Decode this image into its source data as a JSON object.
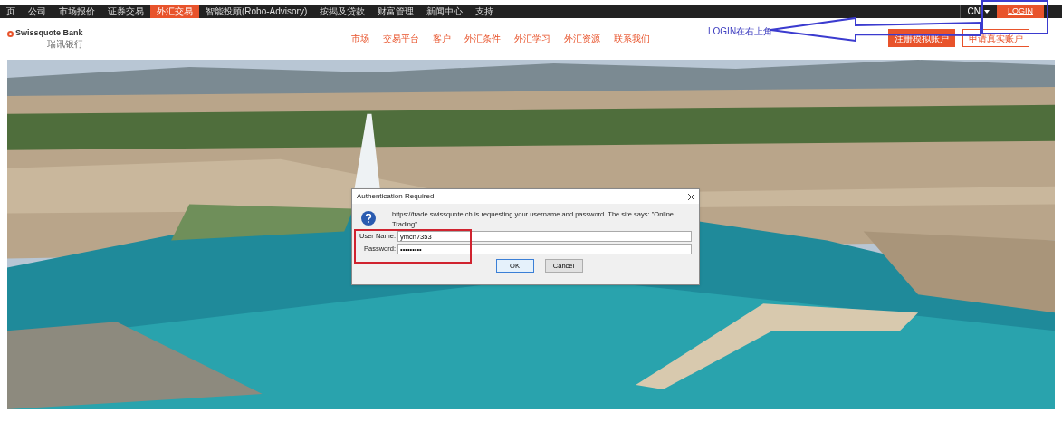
{
  "top_nav": {
    "items": [
      {
        "label": "页",
        "selected": false
      },
      {
        "label": "公司",
        "selected": false
      },
      {
        "label": "市场报价",
        "selected": false
      },
      {
        "label": "证券交易",
        "selected": false
      },
      {
        "label": "外汇交易",
        "selected": true
      },
      {
        "label": "智能投顾(Robo-Advisory)",
        "selected": false
      },
      {
        "label": "按揭及贷款",
        "selected": false
      },
      {
        "label": "财富管理",
        "selected": false
      },
      {
        "label": "新闻中心",
        "selected": false
      },
      {
        "label": "支持",
        "selected": false
      }
    ],
    "language": "CN",
    "login": "LOGIN"
  },
  "header": {
    "logo": "Swissquote Bank",
    "logo_sub": "瑞讯银行",
    "nav": [
      "市场",
      "交易平台",
      "客户",
      "外汇条件",
      "外汇学习",
      "外汇资源",
      "联系我们"
    ],
    "buttons": [
      {
        "label": "注册模拟账户",
        "kind": "primary"
      },
      {
        "label": "申请真实账户",
        "kind": "outline"
      }
    ]
  },
  "annotation": {
    "text": "LOGIN在右上角"
  },
  "dialog": {
    "title": "Authentication Required",
    "message": "https://trade.swissquote.ch is requesting your username and password. The site says: \"Online Trading\"",
    "fields": [
      {
        "label": "User Name:",
        "value": "ymch7353"
      },
      {
        "label": "Password:",
        "value": "•••••••••"
      }
    ],
    "buttons": [
      {
        "label": "OK",
        "kind": "default"
      },
      {
        "label": "Cancel",
        "kind": "normal"
      }
    ]
  }
}
